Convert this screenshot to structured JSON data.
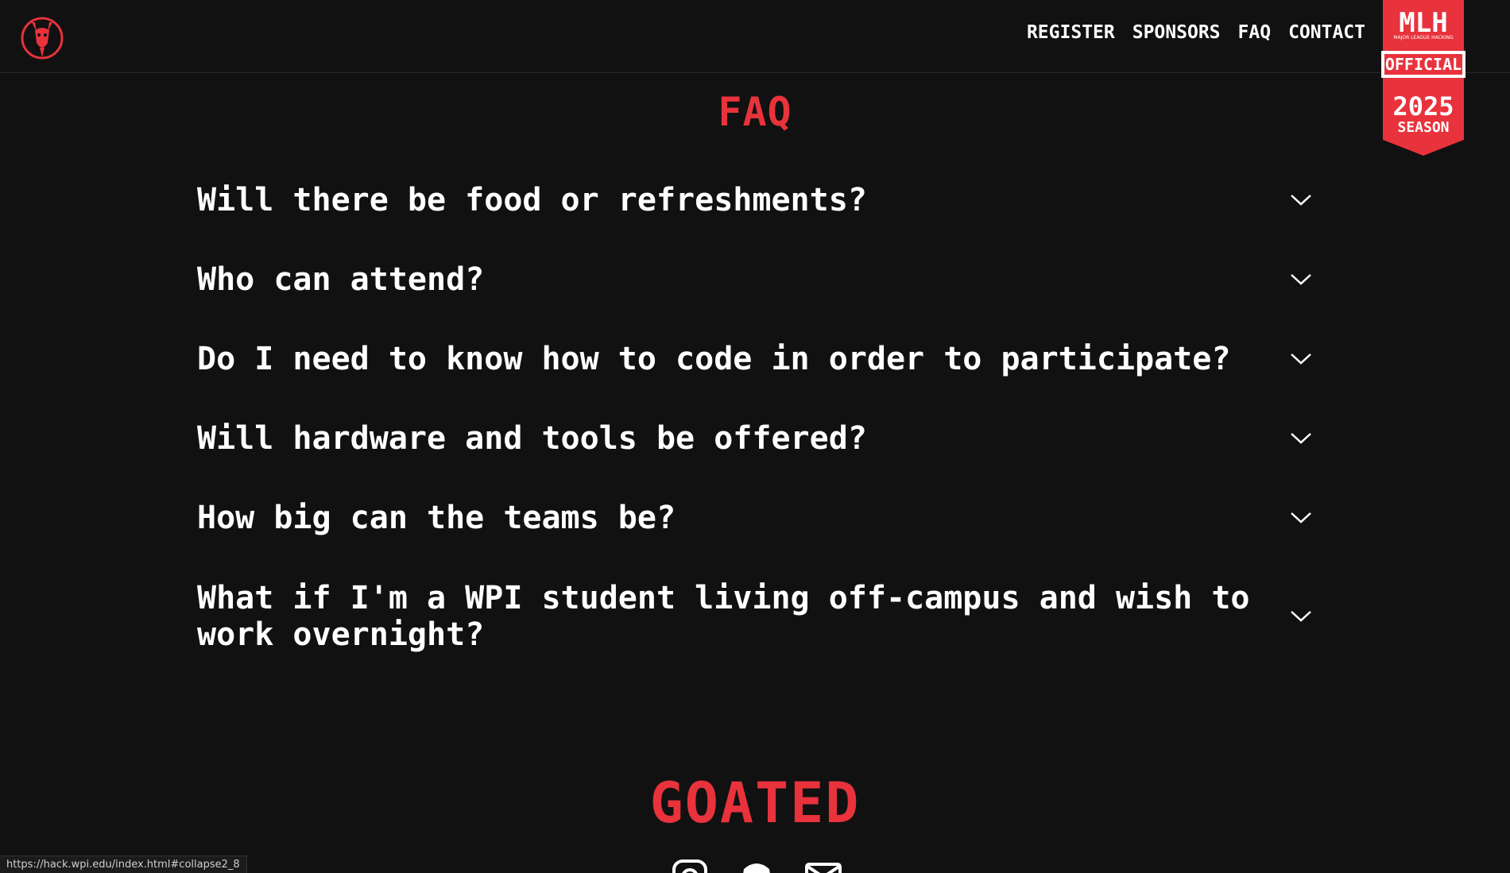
{
  "nav": {
    "items": [
      {
        "label": "REGISTER"
      },
      {
        "label": "SPONSORS"
      },
      {
        "label": "FAQ"
      },
      {
        "label": "CONTACT"
      }
    ]
  },
  "mlh_badge": {
    "brand": "MLH",
    "tagline": "MAJOR LEAGUE HACKING",
    "official": "OFFICIAL",
    "year": "2025",
    "season": "SEASON"
  },
  "faq": {
    "title": "FAQ",
    "questions": [
      "Will there be food or refreshments?",
      "Who can attend?",
      "Do I need to know how to code in order to participate?",
      "Will hardware and tools be offered?",
      "How big can the teams be?",
      "What if I'm a WPI student living off-campus and wish to work overnight?"
    ]
  },
  "footer": {
    "brand": "GOATED"
  },
  "status_bar": {
    "url": "https://hack.wpi.edu/index.html#collapse2_8"
  },
  "colors": {
    "accent": "#e8323c",
    "background": "#111111",
    "text": "#ffffff"
  },
  "icons": {
    "logo": "goat-logo-icon",
    "chevron": "chevron-down-icon",
    "social": [
      "instagram-icon",
      "discord-icon",
      "email-icon"
    ]
  }
}
